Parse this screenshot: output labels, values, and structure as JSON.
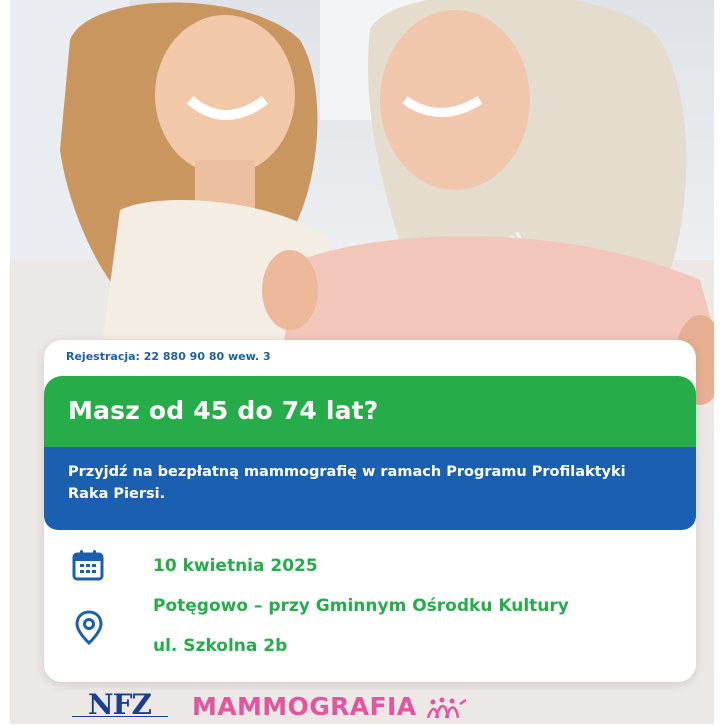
{
  "registration": {
    "label": "Rejestracja: 22 880 90 80 wew. 3"
  },
  "headline": {
    "text": "Masz od 45 do 74 lat?"
  },
  "subheadline": {
    "text": "Przyjdź na bezpłatną mammografię w ramach Programu Profilaktyki Raka Piersi."
  },
  "details": {
    "date": "10 kwietnia 2025",
    "place": "Potęgowo – przy Gminnym Ośrodku Kultury",
    "street": "ul. Szkolna 2b"
  },
  "footer": {
    "nfz_logo": "NFZ",
    "mammografia_logo": "MAMMOGRAFIA"
  },
  "icons": {
    "calendar": "calendar-icon",
    "location": "location-pin-icon",
    "ribbon": "mammography-logo-icon"
  },
  "colors": {
    "green": "#27ac4a",
    "blue": "#1a5fb0",
    "registration_text": "#1d5fa8",
    "nfz": "#1c3f8c",
    "mammografia": "#e3559f"
  }
}
